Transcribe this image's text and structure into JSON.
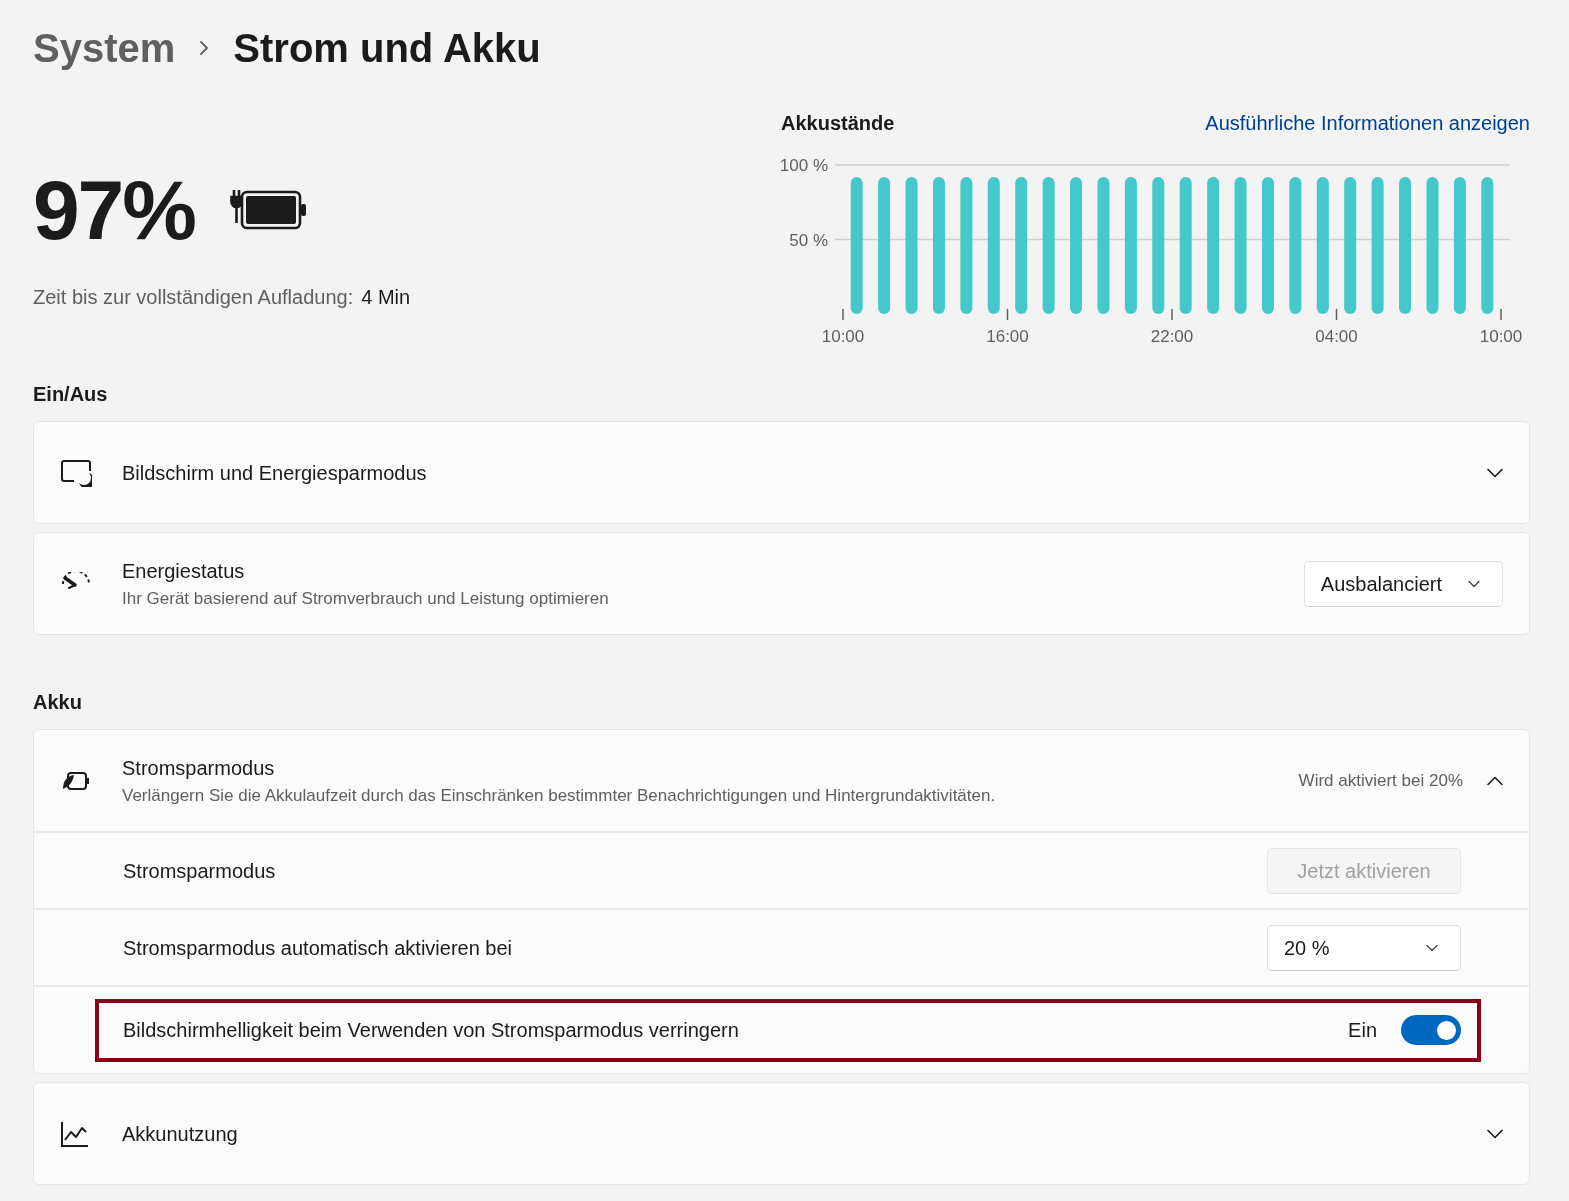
{
  "breadcrumb": {
    "parent": "System",
    "current": "Strom und Akku"
  },
  "battery": {
    "percent": "97%",
    "charging": true,
    "time_label": "Zeit bis zur vollständigen Aufladung:",
    "time_value": "4 Min"
  },
  "chart_panel": {
    "title": "Akkustände",
    "link": "Ausführliche Informationen anzeigen",
    "axis_end_label": "10:00",
    "chart_data": {
      "type": "bar",
      "categories": [
        "10:00",
        null,
        null,
        null,
        null,
        null,
        "16:00",
        null,
        null,
        null,
        null,
        null,
        "22:00",
        null,
        null,
        null,
        null,
        null,
        "04:00",
        null,
        null,
        null,
        null,
        null
      ],
      "series": [
        {
          "color": "#44c8cc",
          "values": [
            92,
            92,
            92,
            92,
            92,
            92,
            92,
            92,
            92,
            92,
            92,
            92,
            92,
            92,
            92,
            92,
            92,
            92,
            92,
            92,
            92,
            92,
            92,
            92
          ]
        }
      ],
      "ylim": [
        0,
        100
      ],
      "yticks": [
        {
          "value": 50,
          "label": "50 %"
        },
        {
          "value": 100,
          "label": "100 %"
        }
      ]
    }
  },
  "sections": [
    {
      "heading": "Ein/Aus",
      "cards": [
        {
          "kind": "expander",
          "title": "Bildschirm und Energiesparmodus",
          "expanded": false
        },
        {
          "kind": "dropdown",
          "title": "Energiestatus",
          "description": "Ihr Gerät basierend auf Stromverbrauch und Leistung optimieren",
          "value": "Ausbalanciert"
        }
      ]
    },
    {
      "heading": "Akku",
      "cards": [
        {
          "kind": "expander",
          "title": "Stromsparmodus",
          "description": "Verlängern Sie die Akkulaufzeit durch das Einschränken bestimmter Benachrichtigungen und Hintergrundaktivitäten.",
          "status": "Wird aktiviert bei 20%",
          "expanded": true,
          "rows": [
            {
              "kind": "button",
              "label": "Stromsparmodus",
              "button": "Jetzt aktivieren",
              "disabled": true,
              "highlighted": false
            },
            {
              "kind": "dropdown",
              "label": "Stromsparmodus automatisch aktivieren bei",
              "value": "20 %",
              "highlighted": false
            },
            {
              "kind": "toggle",
              "label": "Bildschirmhelligkeit beim Verwenden von Stromsparmodus verringern",
              "state_label": "Ein",
              "on": true,
              "highlighted": true
            }
          ]
        },
        {
          "kind": "expander",
          "title": "Akkunutzung",
          "expanded": false
        }
      ]
    }
  ]
}
